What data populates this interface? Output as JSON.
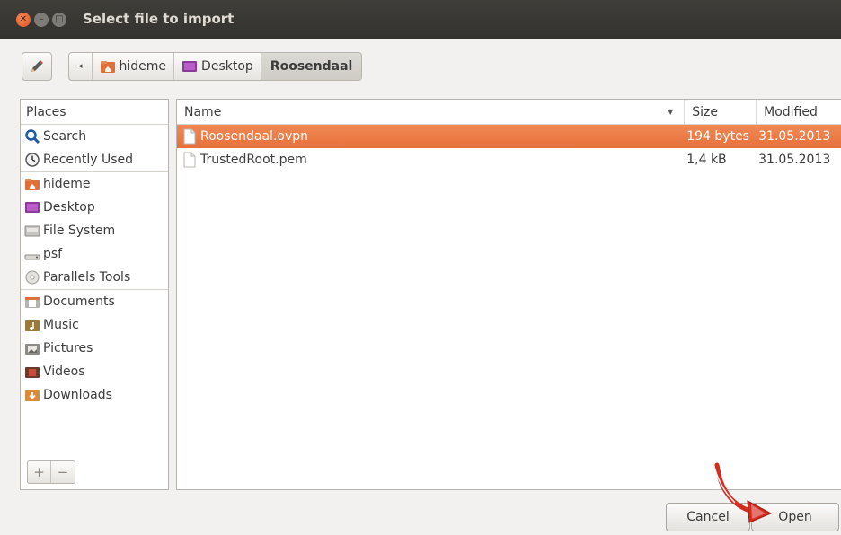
{
  "window": {
    "title": "Select file to import"
  },
  "pathbar": {
    "crumbs": [
      "hideme",
      "Desktop",
      "Roosendaal"
    ]
  },
  "places": {
    "header": "Places",
    "items": [
      {
        "label": "Search",
        "icon": "search-icon"
      },
      {
        "label": "Recently Used",
        "icon": "recent-icon"
      },
      {
        "label": "hideme",
        "icon": "home-folder-icon"
      },
      {
        "label": "Desktop",
        "icon": "desktop-icon"
      },
      {
        "label": "File System",
        "icon": "filesystem-icon"
      },
      {
        "label": "psf",
        "icon": "drive-icon"
      },
      {
        "label": "Parallels Tools",
        "icon": "disc-icon"
      },
      {
        "label": "Documents",
        "icon": "documents-folder-icon"
      },
      {
        "label": "Music",
        "icon": "music-folder-icon"
      },
      {
        "label": "Pictures",
        "icon": "pictures-folder-icon"
      },
      {
        "label": "Videos",
        "icon": "videos-folder-icon"
      },
      {
        "label": "Downloads",
        "icon": "downloads-folder-icon"
      }
    ],
    "add_label": "+",
    "remove_label": "−"
  },
  "files": {
    "columns": {
      "name": "Name",
      "size": "Size",
      "modified": "Modified"
    },
    "rows": [
      {
        "name": "Roosendaal.ovpn",
        "size": "194 bytes",
        "modified": "31.05.2013",
        "selected": true
      },
      {
        "name": "TrustedRoot.pem",
        "size": "1,4 kB",
        "modified": "31.05.2013",
        "selected": false
      }
    ]
  },
  "buttons": {
    "cancel": "Cancel",
    "open": "Open"
  },
  "colors": {
    "selection": "#e8703a",
    "titlebar": "#3a3935",
    "close_button": "#e0501e"
  }
}
